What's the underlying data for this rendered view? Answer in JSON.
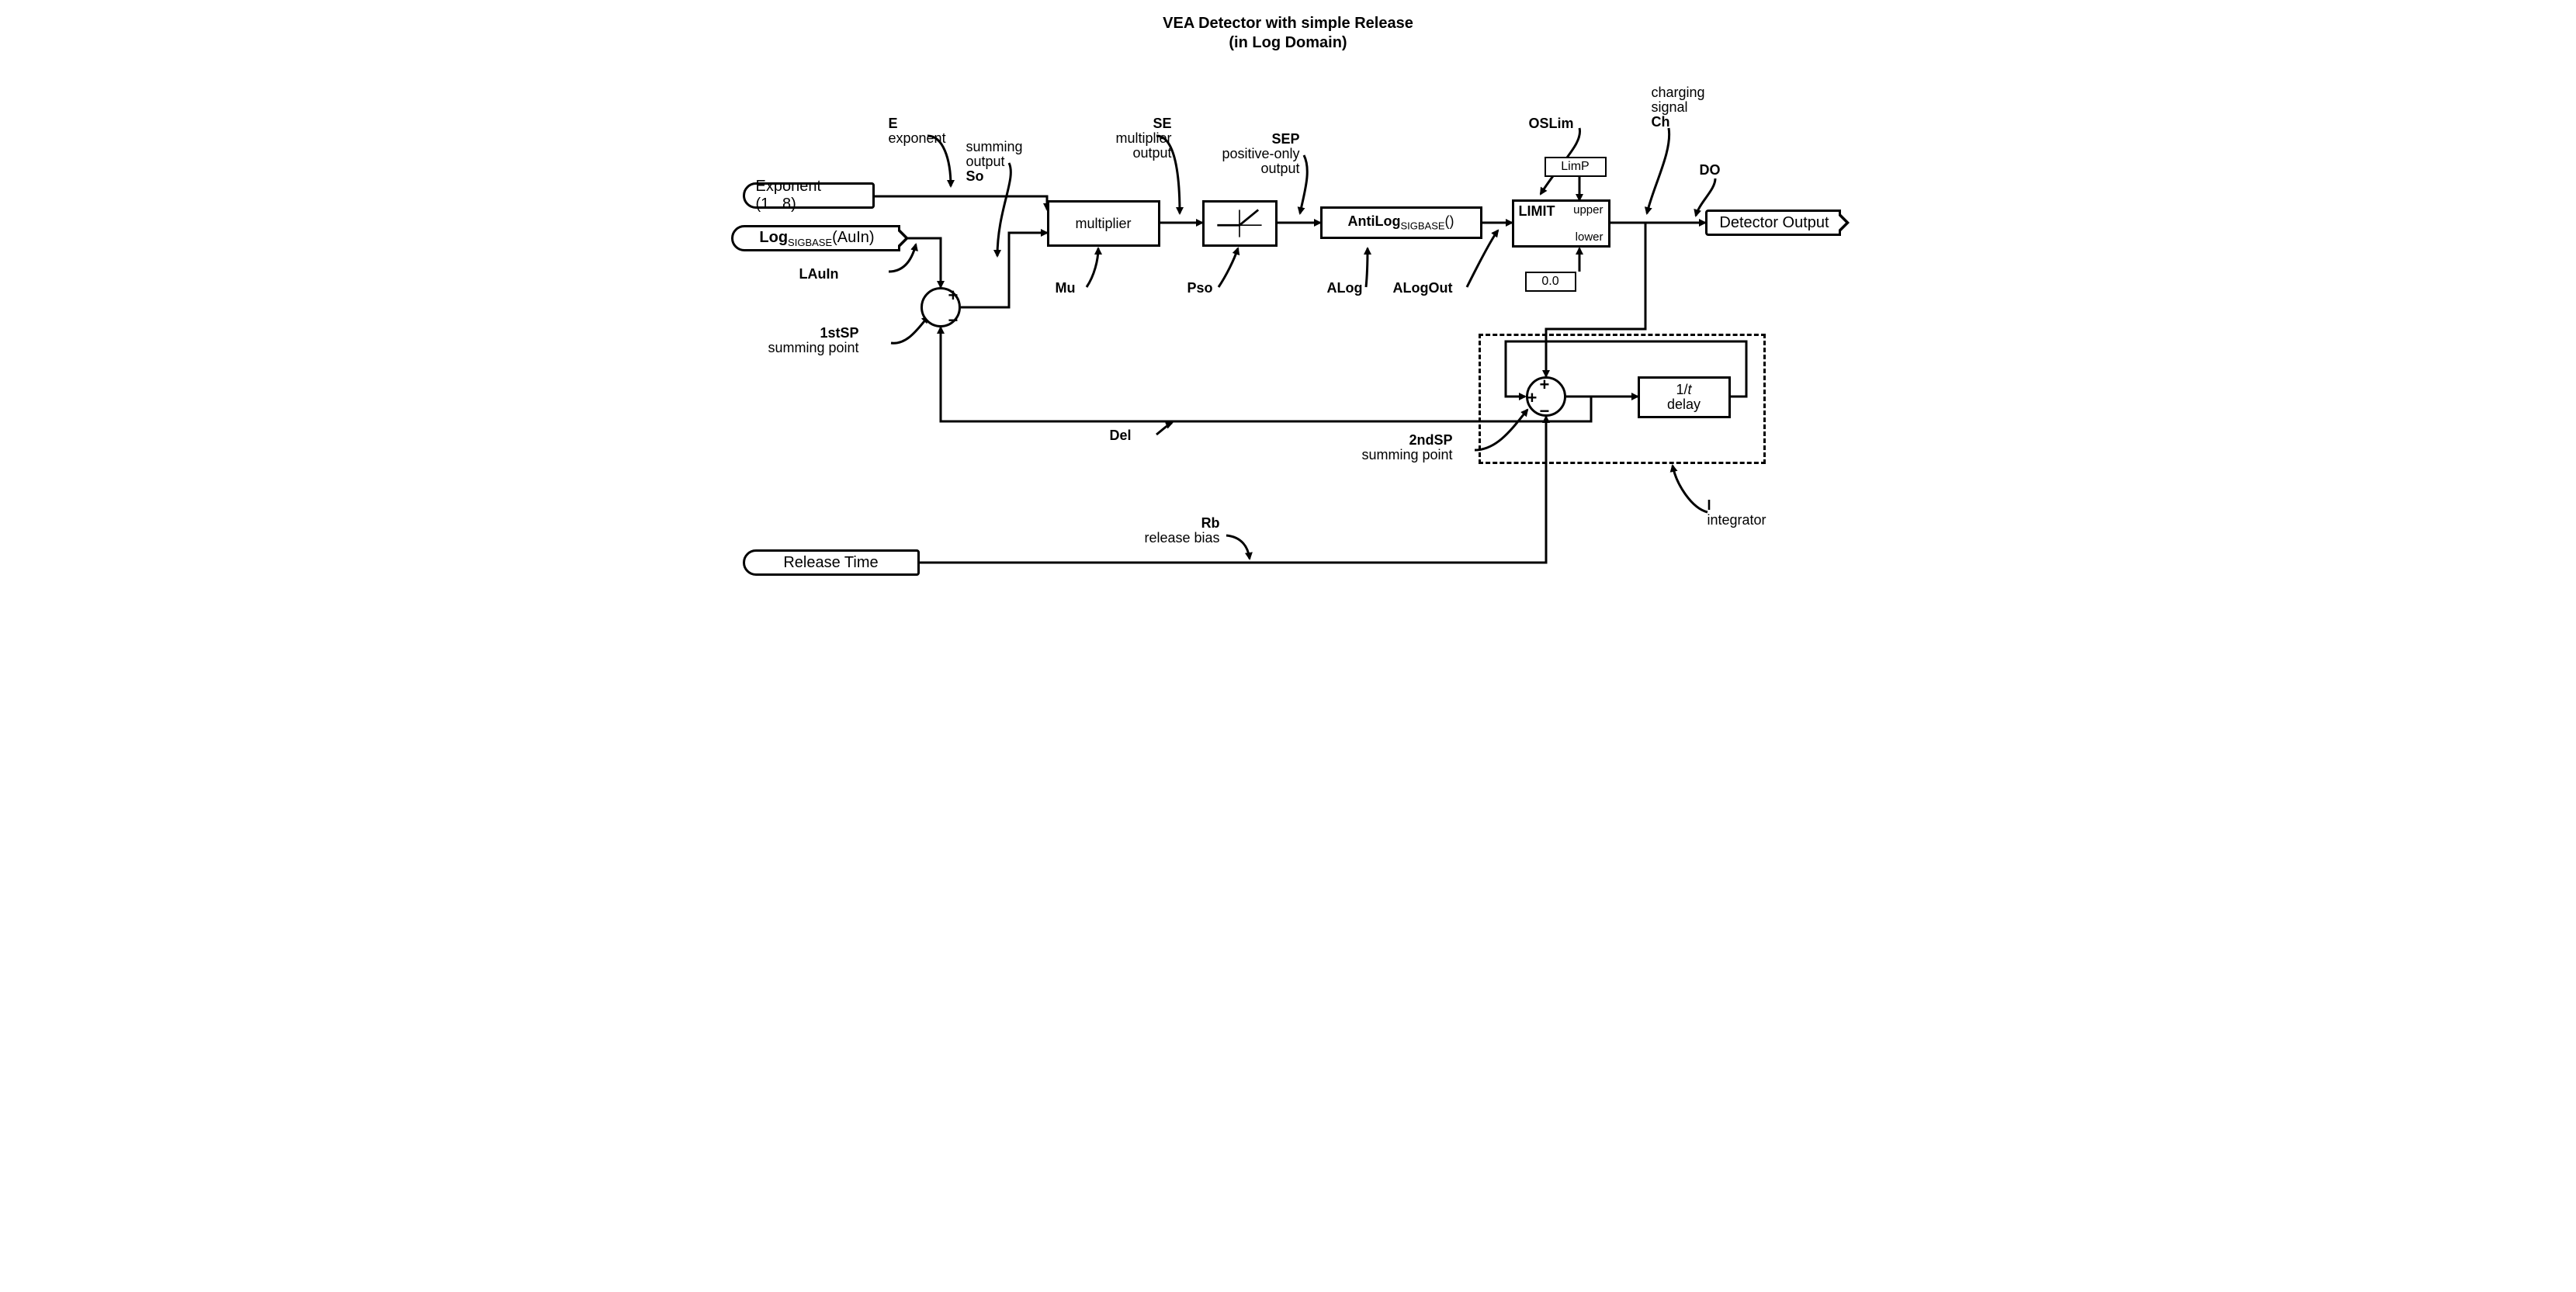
{
  "title_line1": "VEA Detector with simple Release",
  "title_line2": "(in Log Domain)",
  "inputs": {
    "exponent": "Exponent (1...8)",
    "log_sigbase_auin_lead": "Log",
    "log_sigbase_auin_sub": "SIGBASE",
    "log_sigbase_auin_tail": "(AuIn)",
    "release_time": "Release Time"
  },
  "outputs": {
    "detector_output": "Detector Output"
  },
  "blocks": {
    "multiplier": "multiplier",
    "antilog_lead": "AntiLog",
    "antilog_sub": "SIGBASE",
    "antilog_tail": "()",
    "limit": "LIMIT",
    "limit_upper": "upper",
    "limit_lower": "lower",
    "limP": "LimP",
    "zero": "0.0",
    "delay_line1": "1/t",
    "delay_line2": "delay"
  },
  "annotations": {
    "E_sym": "E",
    "E_desc": "exponent",
    "So_sym": "So",
    "So_desc1": "summing",
    "So_desc2": "output",
    "SE_sym": "SE",
    "SE_desc1": "multiplier",
    "SE_desc2": "output",
    "SEP_sym": "SEP",
    "SEP_desc1": "positive-only",
    "SEP_desc2": "output",
    "OSLim_sym": "OSLim",
    "Ch_sym": "Ch",
    "Ch_desc1": "charging",
    "Ch_desc2": "signal",
    "DO_sym": "DO",
    "LAuIn_sym": "LAuIn",
    "firstSP_sym": "1stSP",
    "firstSP_desc": "summing  point",
    "Mu_sym": "Mu",
    "Pso_sym": "Pso",
    "ALog_sym": "ALog",
    "ALogOut_sym": "ALogOut",
    "Del_sym": "Del",
    "secondSP_sym": "2ndSP",
    "secondSP_desc": "summing  point",
    "Rb_sym": "Rb",
    "Rb_desc": "release bias",
    "I_sym": "I",
    "I_desc": "integrator"
  }
}
